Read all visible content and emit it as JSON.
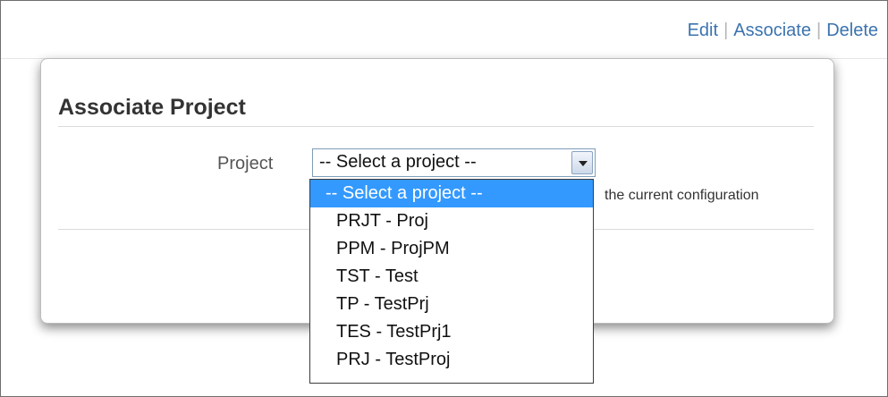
{
  "header": {
    "actions": [
      {
        "label": "Edit"
      },
      {
        "label": "Associate"
      },
      {
        "label": "Delete"
      }
    ],
    "separator": "|"
  },
  "dialog": {
    "title": "Associate Project",
    "field_label": "Project",
    "select_value": "-- Select a project --",
    "help_text": "the current configuration",
    "options": [
      "-- Select a project --",
      "PRJT - Proj",
      "PPM - ProjPM",
      "TST - Test",
      "TP - TestPrj",
      "TES - TestPrj1",
      "PRJ - TestProj"
    ],
    "highlight_color": "#3399ff",
    "link_color": "#3b73af"
  }
}
